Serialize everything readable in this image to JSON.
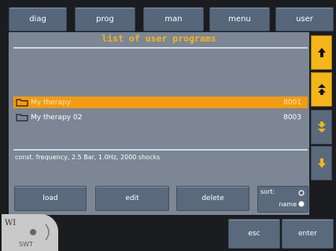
{
  "tabs": [
    "diag",
    "prog",
    "man",
    "menu",
    "user"
  ],
  "panel": {
    "title": "list of user programs",
    "programs": [
      {
        "name": "My therapy",
        "number": "8001",
        "selected": true
      },
      {
        "name": "My therapy 02",
        "number": "8003",
        "selected": false
      }
    ],
    "status": "const. frequency, 2.5 Bar, 1.0Hz, 2000 shocks"
  },
  "actions": {
    "load": "load",
    "edit": "edit",
    "delete": "delete"
  },
  "sort": {
    "label": "sort:",
    "option_selected": "name"
  },
  "footer": {
    "esc": "esc",
    "enter": "enter"
  },
  "logo": {
    "top": "WI",
    "bottom": "SWT"
  },
  "colors": {
    "accent": "#f5b41c",
    "selected_row": "#f39c12",
    "panel": "#7c8694",
    "button": "#5a6a7c"
  },
  "side_buttons": [
    "arrow-up-icon",
    "double-arrow-up-icon",
    "double-arrow-down-icon",
    "arrow-down-icon"
  ]
}
